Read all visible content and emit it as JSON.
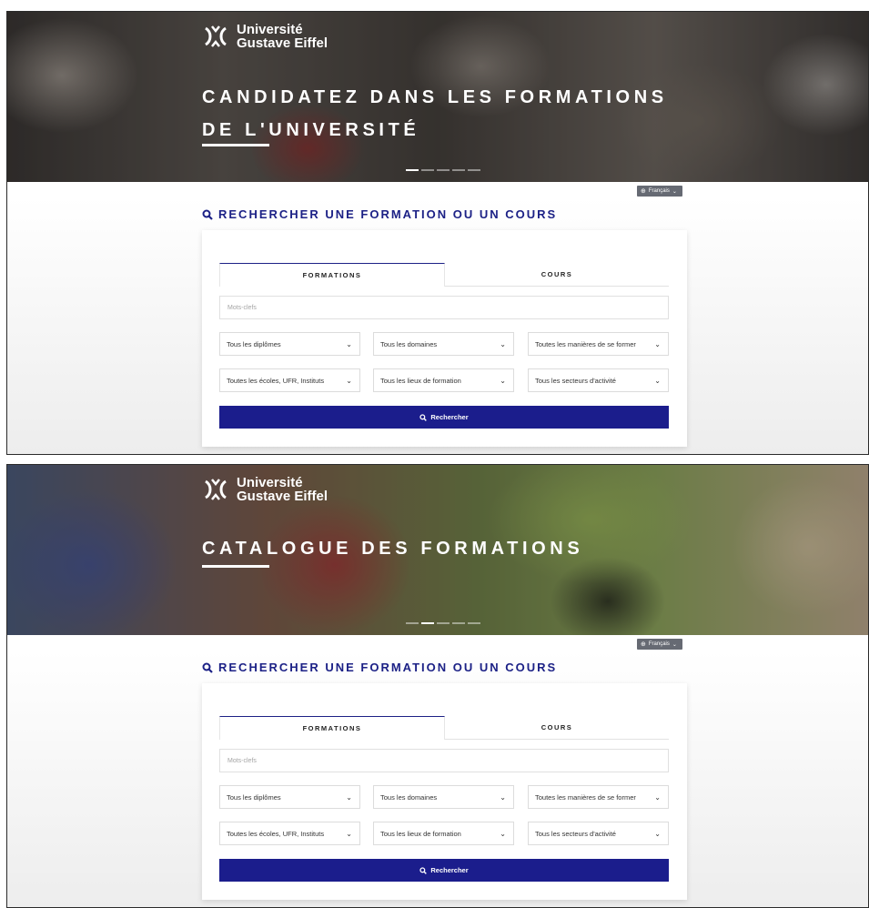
{
  "brand": {
    "line1": "Université",
    "line2": "Gustave Eiffel"
  },
  "colors": {
    "accent": "#1c2186",
    "button": "#1b1d8c",
    "lang_badge": "#666a73"
  },
  "screens": [
    {
      "hero_title_lines": [
        "CANDIDATEZ DANS LES FORMATIONS",
        "DE L'UNIVERSITÉ"
      ],
      "carousel_active": 0
    },
    {
      "hero_title_lines": [
        "CATALOGUE DES FORMATIONS",
        ""
      ],
      "carousel_active": 1
    }
  ],
  "language": {
    "label": "Français"
  },
  "search": {
    "heading": "RECHERCHER UNE FORMATION OU UN COURS",
    "tabs": [
      {
        "label": "FORMATIONS",
        "active": true
      },
      {
        "label": "COURS",
        "active": false
      }
    ],
    "keywords_placeholder": "Mots-clefs",
    "filters": [
      "Tous les diplômes",
      "Tous les domaines",
      "Toutes les manières de se former",
      "Toutes les écoles, UFR, Instituts",
      "Tous les lieux de formation",
      "Tous les secteurs d'activité"
    ],
    "submit_label": "Rechercher"
  }
}
